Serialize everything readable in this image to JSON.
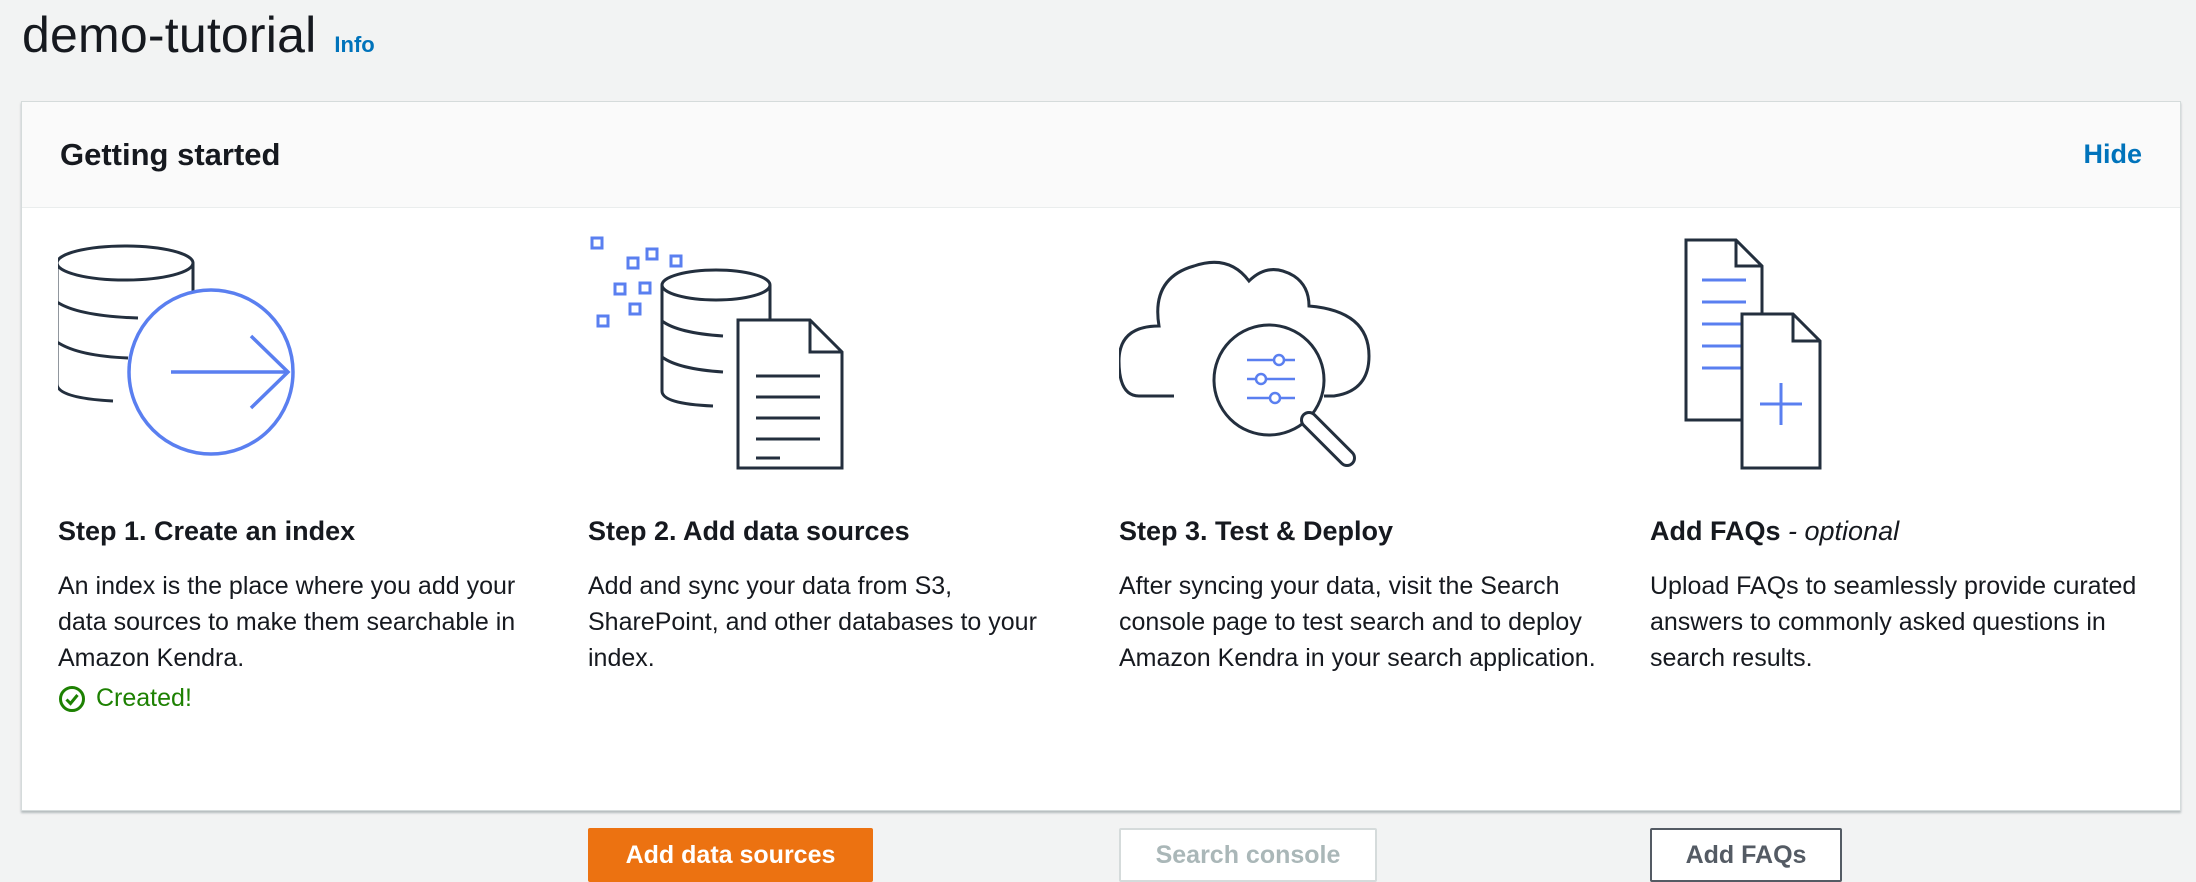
{
  "page": {
    "title": "demo-tutorial",
    "info_label": "Info"
  },
  "panel": {
    "title": "Getting started",
    "hide_label": "Hide"
  },
  "steps": [
    {
      "title": "Step 1. Create an index",
      "description": "An index is the place where you add your data sources to make them searchable in Amazon Kendra.",
      "status": "Created!",
      "icon": "database-arrow-icon"
    },
    {
      "title": "Step 2. Add data sources",
      "description": "Add and sync your data from S3, SharePoint, and other databases to your index.",
      "button": "Add data sources",
      "icon": "database-document-icon"
    },
    {
      "title": "Step 3. Test & Deploy",
      "description": "After syncing your data, visit the Search console page to test search and to deploy Amazon Kendra in your search application.",
      "button": "Search console",
      "button_disabled": true,
      "icon": "cloud-search-icon"
    },
    {
      "title": "Add FAQs",
      "title_suffix": "- optional",
      "description": "Upload FAQs to seamlessly provide curated answers to commonly asked questions in search results.",
      "button": "Add FAQs",
      "icon": "faq-documents-icon"
    }
  ],
  "colors": {
    "accent_blue": "#5a7ff0",
    "link": "#0073bb",
    "primary_button": "#ec7211",
    "success": "#1d8102",
    "line_dark": "#232f3e"
  }
}
